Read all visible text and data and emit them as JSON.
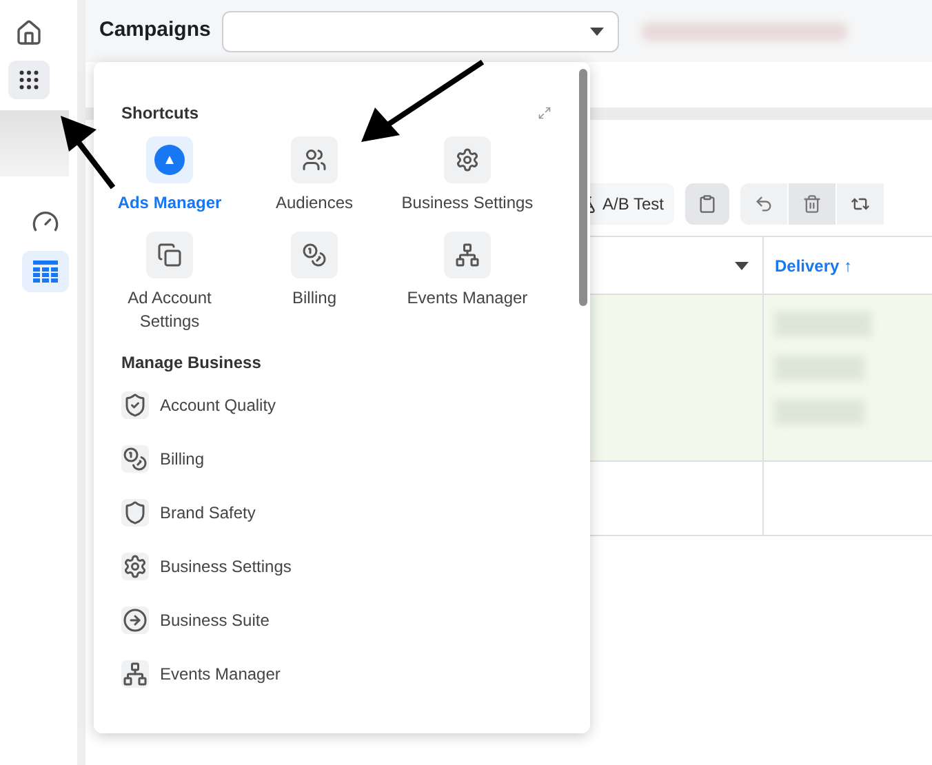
{
  "top_bar": {
    "title": "Campaigns"
  },
  "apps_button": {
    "expanded": true
  },
  "sidebar": {
    "items": [
      {
        "kind": "gauge",
        "selected": false
      },
      {
        "kind": "table",
        "selected": true
      }
    ]
  },
  "toolbar": {
    "ab_test": "A/B Test"
  },
  "table": {
    "columns": [
      {
        "label": "Delivery ↑",
        "sorted": true
      }
    ],
    "rows": [
      {
        "highlighted": true
      },
      {
        "highlighted": false
      }
    ]
  },
  "menu": {
    "shortcuts_title": "Shortcuts",
    "shortcuts": [
      {
        "kind": "ads",
        "label": "Ads Manager",
        "selected": true
      },
      {
        "kind": "people",
        "label": "Audiences",
        "selected": false
      },
      {
        "kind": "gear",
        "label": "Business Settings",
        "selected": false
      },
      {
        "kind": "account",
        "label": "Ad Account Settings",
        "selected": false
      },
      {
        "kind": "coins",
        "label": "Billing",
        "selected": false
      },
      {
        "kind": "events",
        "label": "Events Manager",
        "selected": false
      }
    ],
    "manage_title": "Manage Business",
    "items": [
      {
        "kind": "badge",
        "label": "Account Quality"
      },
      {
        "kind": "coins",
        "label": "Billing"
      },
      {
        "kind": "shield",
        "label": "Brand Safety"
      },
      {
        "kind": "gear",
        "label": "Business Settings"
      },
      {
        "kind": "suite",
        "label": "Business Suite"
      },
      {
        "kind": "events",
        "label": "Events Manager"
      }
    ]
  }
}
